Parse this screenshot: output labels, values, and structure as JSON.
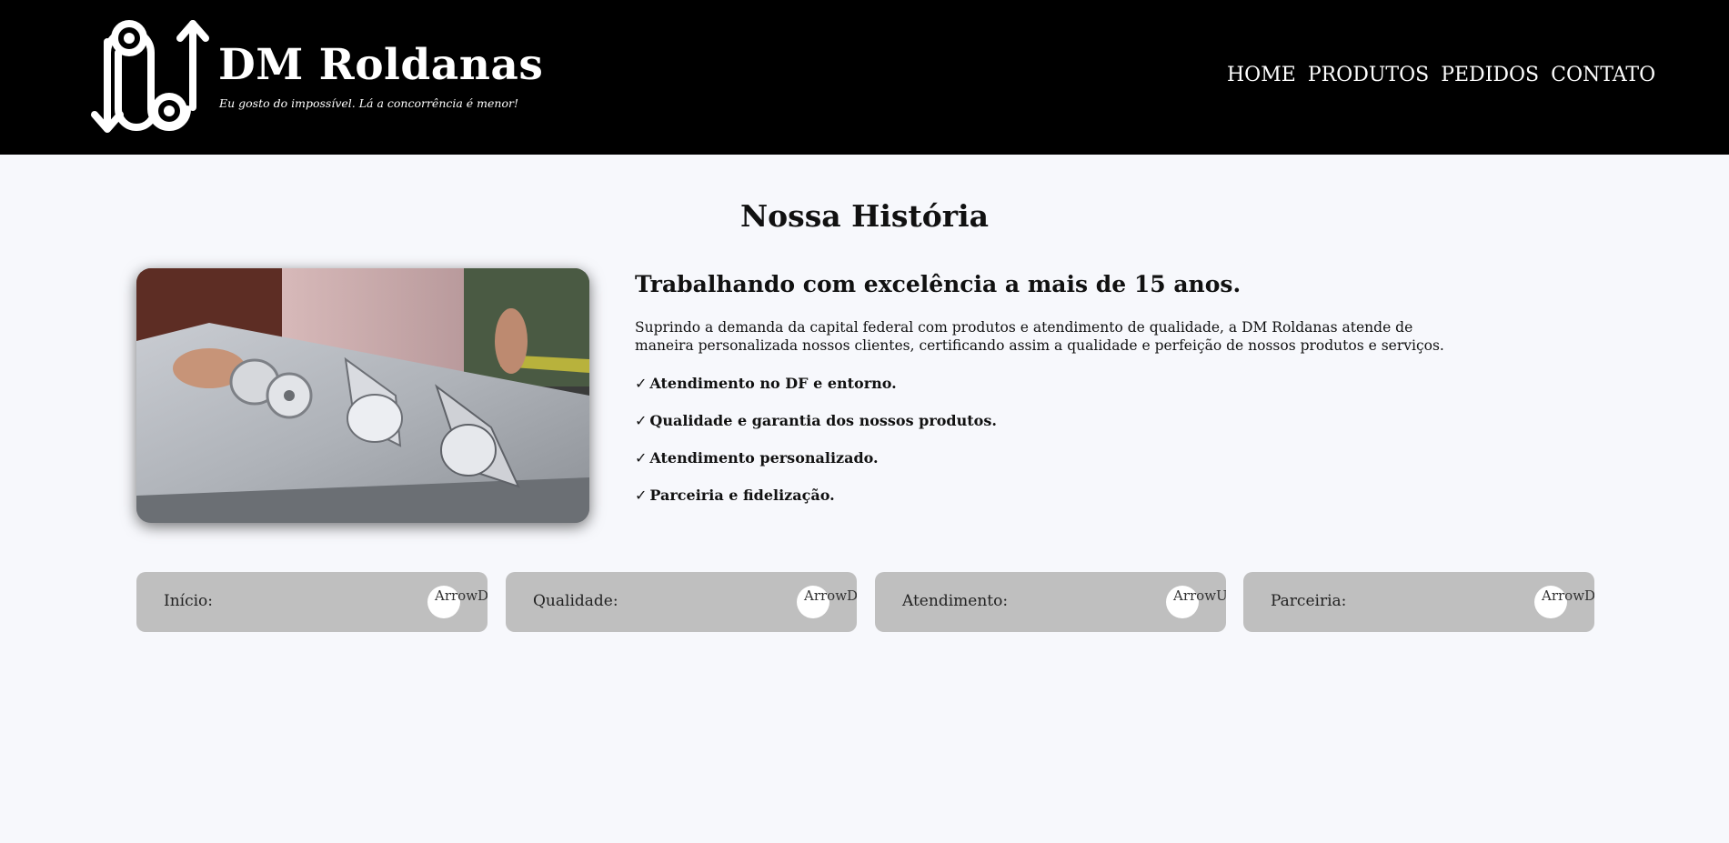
{
  "brand": {
    "name": "DM Roldanas",
    "tagline": "Eu gosto do impossível. Lá a concorrência é menor!"
  },
  "nav": {
    "items": [
      {
        "label": "HOME"
      },
      {
        "label": "PRODUTOS"
      },
      {
        "label": "PEDIDOS"
      },
      {
        "label": "CONTATO"
      }
    ]
  },
  "main": {
    "title": "Nossa História",
    "subtitle": "Trabalhando com excelência a mais de 15 anos.",
    "intro": "Suprindo a demanda da capital federal com produtos e atendimento de qualidade, a DM Roldanas atende de maneira personalizada nossos clientes, certificando assim a qualidade e perfeição de nossos produtos e serviços.",
    "check_symbol": "✓",
    "features": [
      "Atendimento no DF e entorno.",
      "Qualidade e garantia dos nossos produtos.",
      "Atendimento personalizado.",
      "Parceiria e fidelização."
    ]
  },
  "cards": [
    {
      "label": "Início:",
      "arrow_alt": "ArrowD"
    },
    {
      "label": "Qualidade:",
      "arrow_alt": "ArrowD"
    },
    {
      "label": "Atendimento:",
      "arrow_alt": "ArrowU"
    },
    {
      "label": "Parceiria:",
      "arrow_alt": "ArrowD"
    }
  ],
  "colors": {
    "header_bg": "#000000",
    "page_bg": "#f7f8fc",
    "card_bg": "#bfbfbf",
    "text": "#111111"
  }
}
